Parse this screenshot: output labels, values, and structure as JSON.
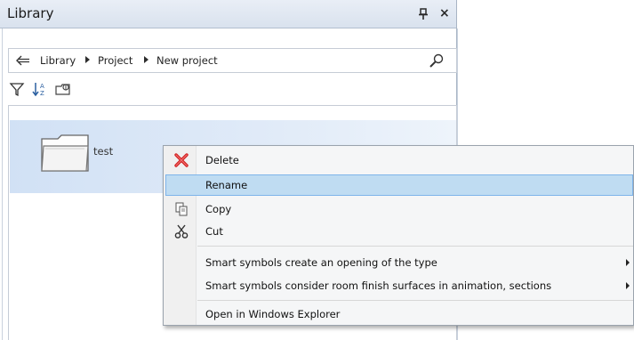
{
  "panel": {
    "title": "Library",
    "close_glyph": "×"
  },
  "breadcrumb": {
    "items": [
      "Library",
      "Project",
      "New project"
    ]
  },
  "toolbar": {
    "icons": [
      "filter-icon",
      "sort-icon",
      "folder-settings-icon"
    ]
  },
  "content": {
    "items": [
      {
        "label": "test",
        "icon": "folder-icon",
        "selected": true
      }
    ]
  },
  "context_menu": {
    "items": [
      {
        "label": "Delete",
        "icon": "delete-x-icon"
      },
      {
        "label": "Rename",
        "icon": "",
        "highlighted": true
      },
      {
        "label": "Copy",
        "icon": "copy-icon"
      },
      {
        "label": "Cut",
        "icon": "scissors-icon"
      },
      {
        "label": "Smart symbols create an opening of the type",
        "submenu": true
      },
      {
        "label": "Smart symbols consider room finish surfaces in animation, sections",
        "submenu": true
      },
      {
        "label": "Open in Windows Explorer"
      }
    ]
  },
  "colors": {
    "accent": "#3399ff",
    "highlight": "#bfdcf2",
    "delete_red": "#d22020"
  }
}
